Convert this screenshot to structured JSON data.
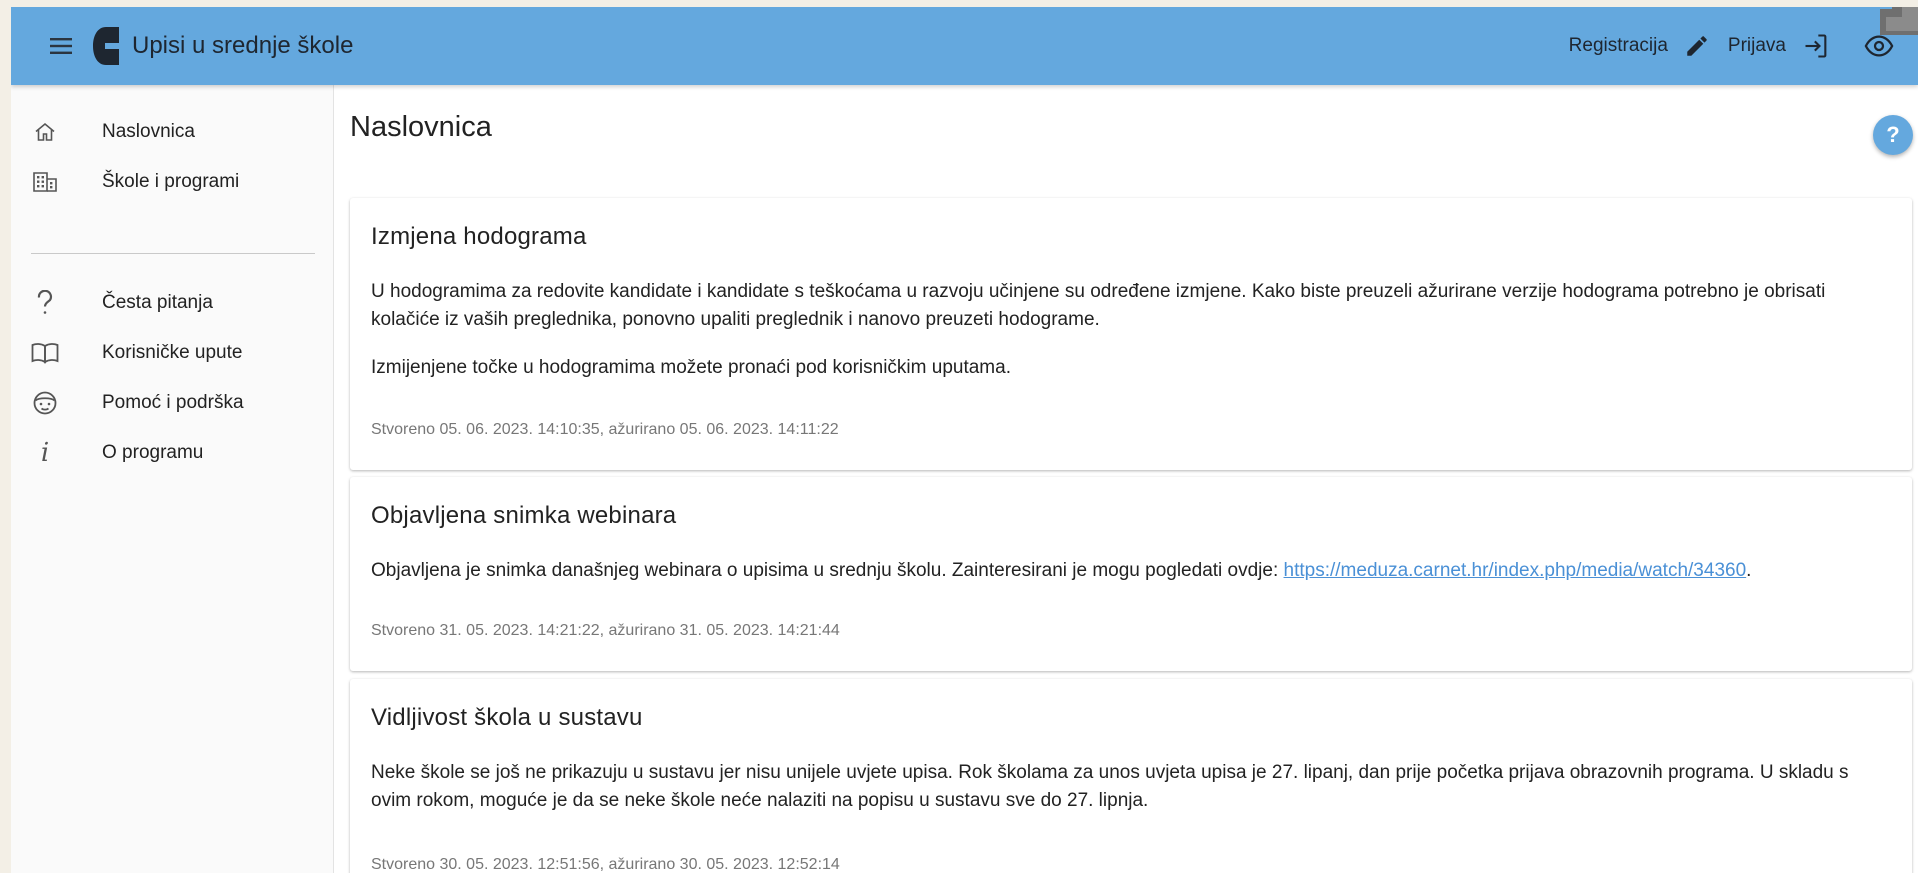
{
  "header": {
    "app_title": "Upisi u srednje škole",
    "registration_label": "Registracija",
    "login_label": "Prijava",
    "bar_color": "#64a8de"
  },
  "sidebar": {
    "items": [
      {
        "label": "Naslovnica",
        "icon": "home-icon"
      },
      {
        "label": "Škole i programi",
        "icon": "building-icon"
      },
      {
        "label": "Česta pitanja",
        "icon": "question-icon"
      },
      {
        "label": "Korisničke upute",
        "icon": "book-icon"
      },
      {
        "label": "Pomoć i podrška",
        "icon": "support-face-icon"
      },
      {
        "label": "O programu",
        "icon": "info-icon"
      }
    ]
  },
  "main": {
    "page_title": "Naslovnica",
    "help_label": "?",
    "cards": [
      {
        "title": "Izmjena hodograma",
        "paragraphs": [
          "U hodogramima za redovite kandidate i kandidate s teškoćama u razvoju učinjene su određene izmjene. Kako biste preuzeli ažurirane verzije hodograma potrebno je obrisati kolačiće iz vaših preglednika, ponovno upaliti preglednik i nanovo preuzeti hodograme.",
          "Izmijenjene točke u hodogramima možete pronaći pod korisničkim uputama."
        ],
        "meta": "Stvoreno 05. 06. 2023. 14:10:35, ažurirano 05. 06. 2023. 14:11:22"
      },
      {
        "title": "Objavljena snimka webinara",
        "text_before_link": "Objavljena je snimka današnjeg webinara o upisima u srednju školu. Zainteresirani je mogu pogledati ovdje: ",
        "link": "https://meduza.carnet.hr/index.php/media/watch/34360",
        "text_after_link": ".",
        "meta": "Stvoreno 31. 05. 2023. 14:21:22, ažurirano 31. 05. 2023. 14:21:44"
      },
      {
        "title": "Vidljivost škola u sustavu",
        "paragraphs": [
          "Neke škole se još ne prikazuju u sustavu jer nisu unijele uvjete upisa. Rok školama za unos uvjeta upisa je 27. lipanj, dan prije početka prijava obrazovnih programa. U skladu s ovim rokom, moguće je da se neke škole neće nalaziti na popisu u sustavu sve do 27. lipnja."
        ],
        "meta": "Stvoreno 30. 05. 2023. 12:51:56, ažurirano 30. 05. 2023. 12:52:14"
      }
    ]
  }
}
